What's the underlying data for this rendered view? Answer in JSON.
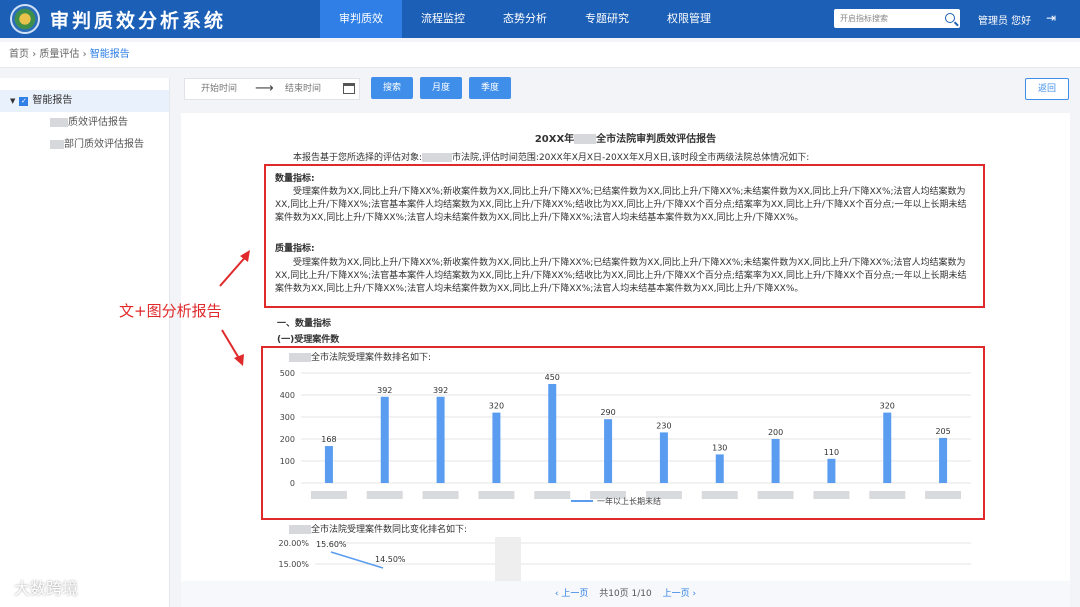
{
  "header": {
    "app_title": "审判质效分析系统",
    "nav": [
      "审判质效",
      "流程监控",
      "态势分析",
      "专题研究",
      "权限管理"
    ],
    "active_nav": 0,
    "search_placeholder": "开启指标搜索",
    "user": "管理员 您好",
    "logout_icon": "logout-icon"
  },
  "breadcrumb": {
    "home": "首页",
    "level2": "质量评估",
    "current": "智能报告",
    "sep": "›"
  },
  "sidebar": {
    "root": "智能报告",
    "children": [
      "质效评估报告",
      "部门质效评估报告"
    ]
  },
  "toolbar": {
    "start_time": "开始时间",
    "end_time": "结束时间",
    "arrow": "⟶",
    "search_btn": "搜索",
    "month_btn": "月度",
    "quarter_btn": "季度",
    "back_btn": "返回"
  },
  "report": {
    "title_prefix": "20XX年",
    "title_suffix": "全市法院审判质效评估报告",
    "intro_a": "本报告基于您所选择的评估对象:",
    "intro_b": "市法院,评估时间范围:20XX年X月X日-20XX年X月X日,该时段全市两级法院总体情况如下:",
    "quantity_heading": "数量指标:",
    "quantity_text": "受理案件数为XX,同比上升/下降XX%;新收案件数为XX,同比上升/下降XX%;已结案件数为XX,同比上升/下降XX%;未结案件数为XX,同比上升/下降XX%;法官人均结案数为XX,同比上升/下降XX%;法官基本案件人均结案数为XX,同比上升/下降XX%;结收比为XX,同比上升/下降XX个百分点;结案率为XX,同比上升/下降XX个百分点;一年以上长期未结案件数为XX,同比上升/下降XX%;法官人均未结案件数为XX,同比上升/下降XX%;法官人均未结基本案件数为XX,同比上升/下降XX%。",
    "quality_heading": "质量指标:",
    "quality_text": "受理案件数为XX,同比上升/下降XX%;新收案件数为XX,同比上升/下降XX%;已结案件数为XX,同比上升/下降XX%;未结案件数为XX,同比上升/下降XX%;法官人均结案数为XX,同比上升/下降XX%;法官基本案件人均结案数为XX,同比上升/下降XX%;结收比为XX,同比上升/下降XX个百分点;结案率为XX,同比上升/下降XX个百分点;一年以上长期未结案件数为XX,同比上升/下降XX%;法官人均未结案件数为XX,同比上升/下降XX%;法官人均未结基本案件数为XX,同比上升/下降XX%。",
    "section1": "一、数量指标",
    "section1_1": "(一)受理案件数",
    "chart1_caption": "全市法院受理案件数排名如下:",
    "chart2_caption": "全市法院受理案件数同比变化排名如下:"
  },
  "chart_data": [
    {
      "type": "bar",
      "categories": [
        "",
        "",
        "",
        "",
        "",
        "",
        "",
        "",
        "",
        "",
        "",
        ""
      ],
      "series": [
        {
          "name": "一年以上长期未结",
          "values": [
            168,
            392,
            392,
            320,
            450,
            290,
            230,
            130,
            200,
            110,
            320,
            205
          ]
        }
      ],
      "ylim": [
        0,
        500
      ],
      "yticks": [
        0,
        100,
        200,
        300,
        400,
        500
      ],
      "legend": "bottom",
      "grid": true,
      "color": "#5a9cf0"
    },
    {
      "type": "line",
      "yticks": [
        "20.00%",
        "15.00%"
      ],
      "values": [
        "15.60%",
        "14.50%"
      ]
    }
  ],
  "pager": {
    "prev": "‹ 上一页",
    "info": "共10页 1/10",
    "next": "上一页 ›"
  },
  "annotation": "文+图分析报告",
  "watermark": "大数跨境",
  "colors": {
    "primary": "#1c5fb6",
    "accent": "#2f7fe6",
    "highlight": "#e0292b"
  }
}
